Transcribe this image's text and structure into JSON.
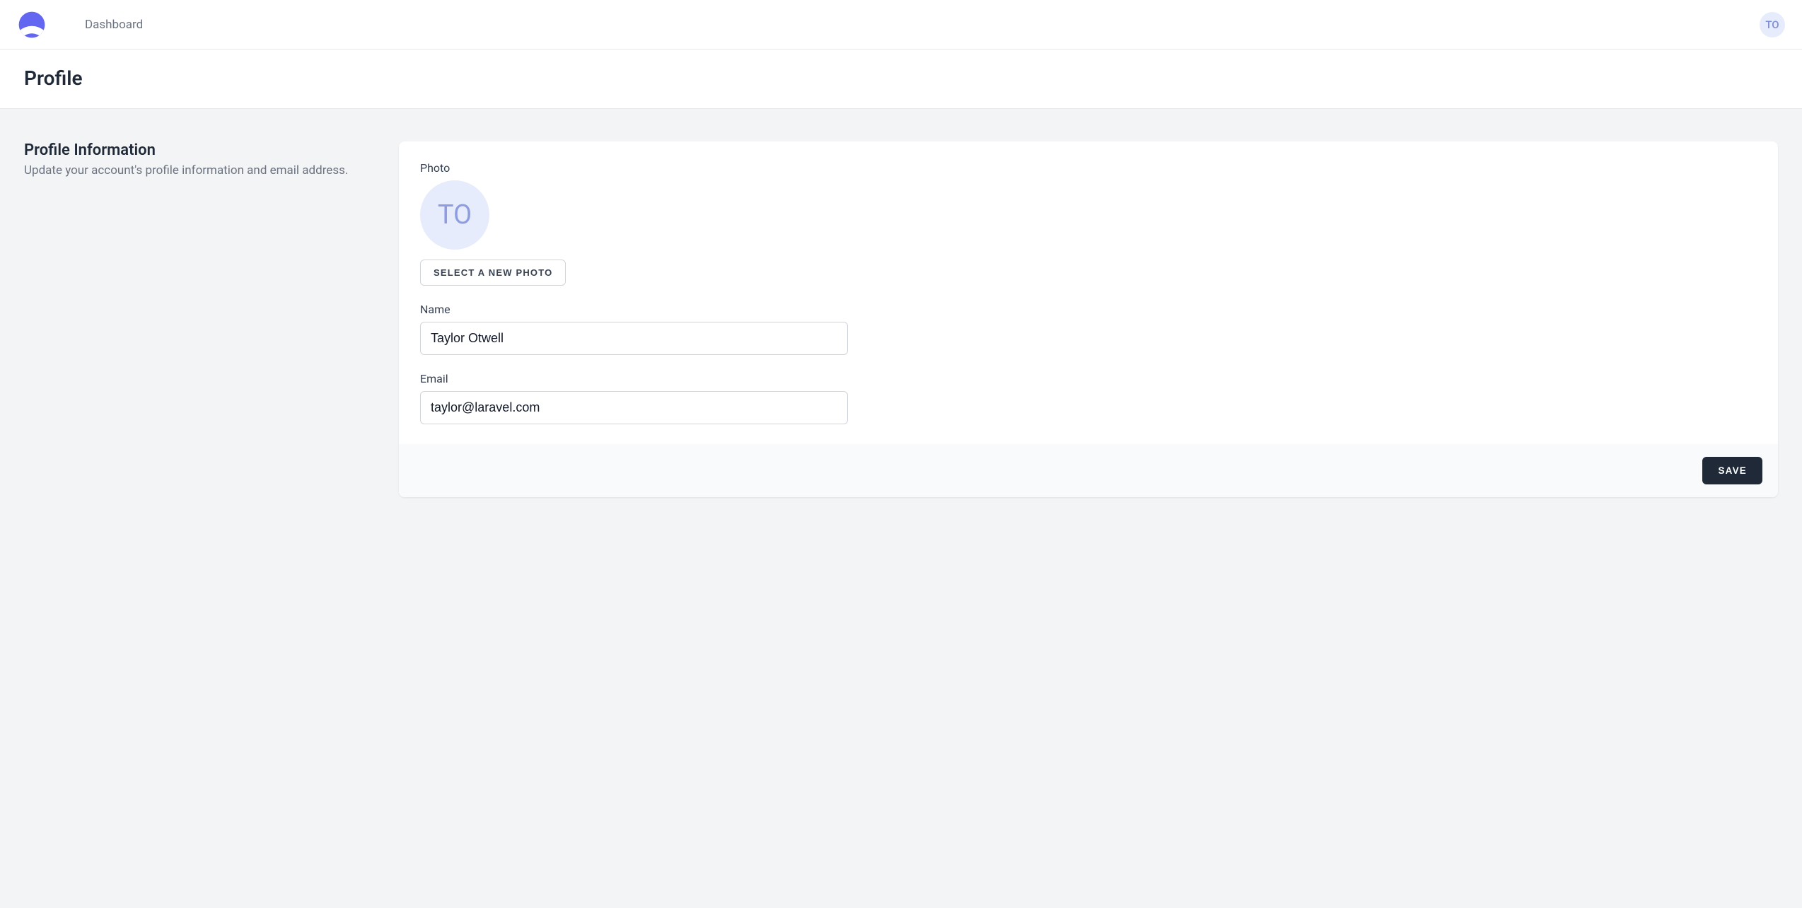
{
  "nav": {
    "dashboard_label": "Dashboard",
    "avatar_initials": "TO"
  },
  "page": {
    "title": "Profile"
  },
  "section": {
    "title": "Profile Information",
    "description": "Update your account's profile information and email address."
  },
  "form": {
    "photo_label": "Photo",
    "avatar_initials": "TO",
    "select_photo_label": "SELECT A NEW PHOTO",
    "name_label": "Name",
    "name_value": "Taylor Otwell",
    "email_label": "Email",
    "email_value": "taylor@laravel.com",
    "save_label": "SAVE"
  }
}
